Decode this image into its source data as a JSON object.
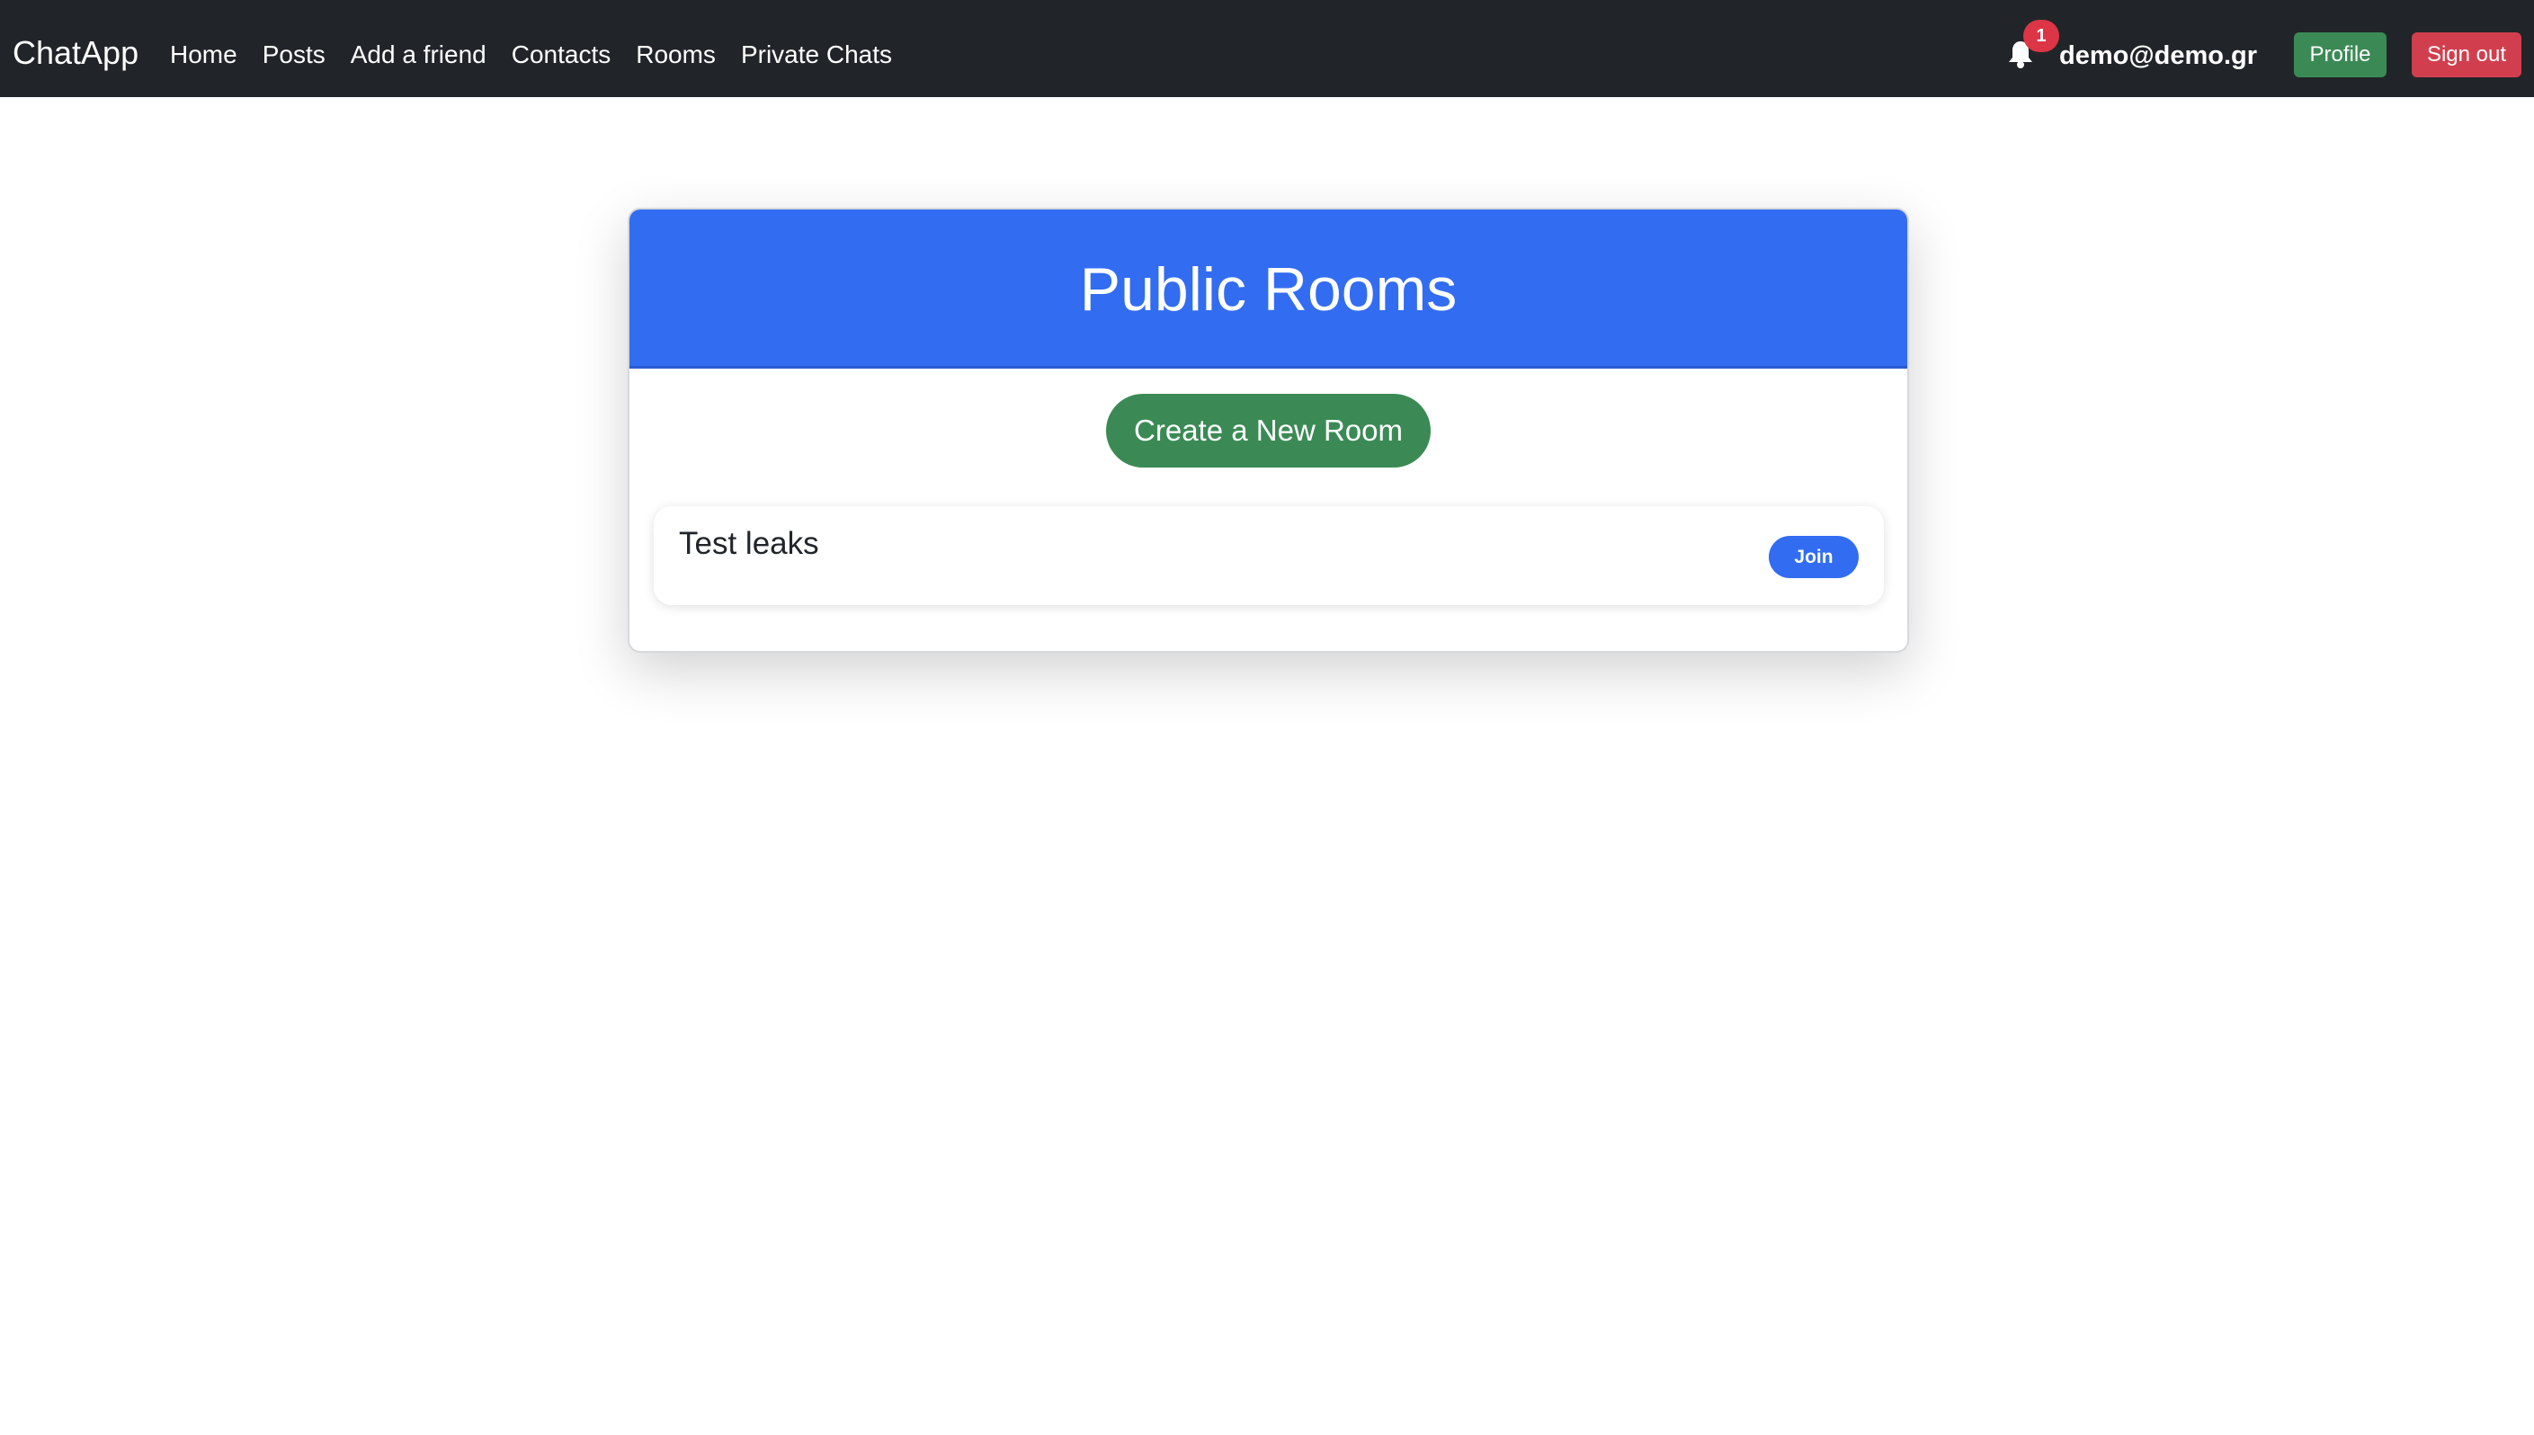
{
  "navbar": {
    "brand": "ChatApp",
    "links": [
      {
        "label": "Home"
      },
      {
        "label": "Posts"
      },
      {
        "label": "Add a friend"
      },
      {
        "label": "Contacts"
      },
      {
        "label": "Rooms"
      },
      {
        "label": "Private Chats"
      }
    ],
    "notifications": {
      "icon": "bell-icon",
      "count": "1"
    },
    "user_email": "demo@demo.gr",
    "profile_label": "Profile",
    "signout_label": "Sign out"
  },
  "main": {
    "title": "Public Rooms",
    "create_label": "Create a New Room",
    "rooms": [
      {
        "name": "Test leaks",
        "join_label": "Join"
      }
    ]
  },
  "colors": {
    "navbar_bg": "#212529",
    "header_blue": "#326cf1",
    "success_green": "#3b8a55",
    "danger_red": "#d13f4e"
  }
}
